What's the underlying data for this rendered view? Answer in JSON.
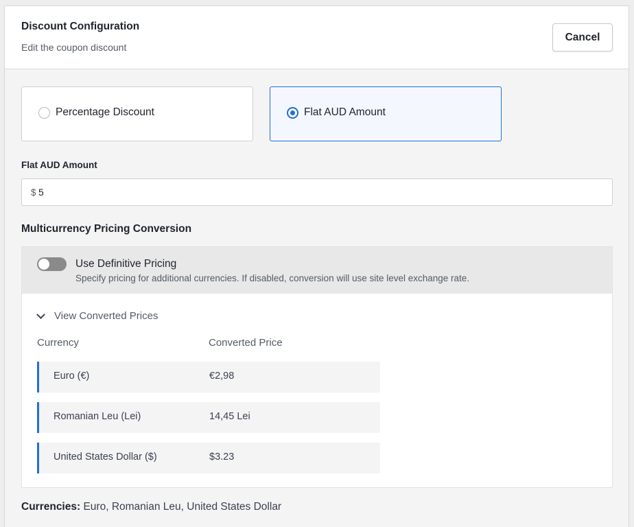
{
  "header": {
    "title": "Discount Configuration",
    "subtitle": "Edit the coupon discount",
    "cancel_label": "Cancel"
  },
  "discount_type": {
    "options": [
      {
        "label": "Percentage Discount",
        "selected": false
      },
      {
        "label": "Flat AUD Amount",
        "selected": true
      }
    ]
  },
  "amount": {
    "label": "Flat AUD Amount",
    "prefix": "$",
    "value": "5"
  },
  "multicurrency": {
    "title": "Multicurrency Pricing Conversion",
    "toggle": {
      "label": "Use Definitive Pricing",
      "description": "Specify pricing for additional currencies. If disabled, conversion will use site level exchange rate.",
      "enabled": false
    },
    "view_label": "View Converted Prices",
    "columns": [
      "Currency",
      "Converted Price"
    ],
    "rows": [
      {
        "currency": "Euro (€)",
        "price": "€2,98"
      },
      {
        "currency": "Romanian Leu (Lei)",
        "price": "14,45 Lei"
      },
      {
        "currency": "United States Dollar ($)",
        "price": "$3.23"
      }
    ]
  },
  "currencies": {
    "label": "Currencies:",
    "value": "Euro, Romanian Leu, United States Dollar"
  },
  "colors": {
    "accent": "#1f6fd6",
    "toggle_off": "#8a8a8a"
  }
}
